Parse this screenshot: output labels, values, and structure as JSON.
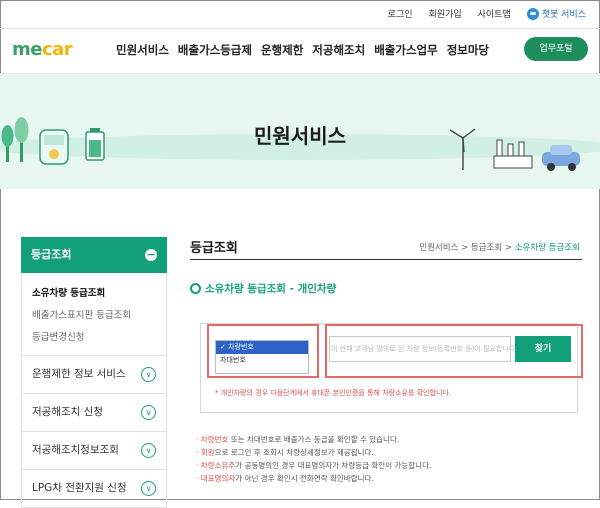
{
  "header": {
    "top_links": [
      "로그인",
      "회원가입",
      "사이트맵"
    ],
    "chatbot_label": "챗봇 서비스"
  },
  "nav": {
    "logo_prefix": "me",
    "logo_suffix": "car",
    "menu": [
      "민원서비스",
      "배출가스등급제",
      "운행제한",
      "저공해조치",
      "배출가스업무",
      "정보마당"
    ],
    "portal_button": "업무포털"
  },
  "hero": {
    "title": "민원서비스"
  },
  "sidebar": {
    "header": "등급조회",
    "sub_items": [
      "소유차량 등급조회",
      "배출가스표지판 등급조회",
      "등급변경신청"
    ],
    "active_index": 0,
    "items": [
      "운행제한 정보 서비스",
      "저공해조치 신청",
      "저공해조치정보조회",
      "LPG차 전환지원 신청"
    ]
  },
  "content": {
    "title": "등급조회",
    "breadcrumb": [
      "민원서비스",
      "등급조회",
      "소유차량 등급조회"
    ],
    "subtitle": "소유차량 등급조회 - 개인차량",
    "select_options": [
      "차량번호",
      "차대번호"
    ],
    "selected_option": "차량번호",
    "search_button": "찾기",
    "bg_hint": "이 현재 고객님 명의로 된 차량 정보(등록번호 등)이 필요합니다",
    "warning": "* 개인차량의 경우 다음단계에서 휴대폰 본인인증을 통해 차량소유를 확인합니다.",
    "notes": [
      {
        "hl": "· 차량번호",
        "rest": " 또는 차대번호로 배출가스 등급을 확인할 수 있습니다."
      },
      {
        "hl": "· 회원",
        "rest": "으로 로그인 후 조회시 차량상세정보가 제공됩니다."
      },
      {
        "hl": "· 차량소유주",
        "rest": "가 공동명의인 경우 대표명의자가 차량등급 확인이 가능합니다."
      },
      {
        "hl": "· 대표명의자",
        "rest": "가 아닌 경우 확인시 전화연락 확인바랍니다."
      }
    ]
  }
}
